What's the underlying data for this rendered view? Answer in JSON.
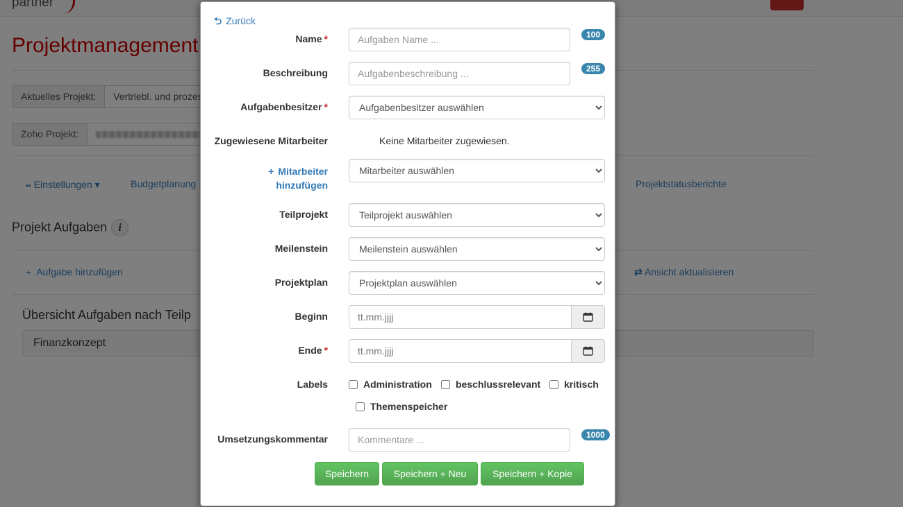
{
  "background": {
    "page_title": "Projektmanagement",
    "current_project_label": "Aktuelles Projekt:",
    "current_project_value": "Vertriebl. und prozes",
    "zoho_project_label": "Zoho Projekt:",
    "tabs": {
      "settings": "Einstellungen",
      "budget": "Budgetplanung",
      "status_reports": "Projektstatusberichte"
    },
    "tasks_heading": "Projekt Aufgaben",
    "add_task": "Aufgabe hinzufügen",
    "refresh_view": "Ansicht aktualisieren",
    "overview_heading": "Übersicht Aufgaben nach Teilp",
    "panel_title": "Finanzkonzept",
    "brand": "partner"
  },
  "modal": {
    "back_label": "Zurück",
    "name": {
      "label": "Name",
      "placeholder": "Aufgaben Name ...",
      "maxlength_badge": "100"
    },
    "description": {
      "label": "Beschreibung",
      "placeholder": "Aufgabenbeschreibung ...",
      "maxlength_badge": "255"
    },
    "owner": {
      "label": "Aufgabenbesitzer",
      "selected": "Aufgabenbesitzer auswählen"
    },
    "assigned": {
      "label": "Zugewiesene Mitarbeiter",
      "value": "Keine Mitarbeiter zugewiesen."
    },
    "add_member": {
      "label_line1": "Mitarbeiter",
      "label_line2": "hinzufügen",
      "selected": "Mitarbeiter auswählen"
    },
    "subproject": {
      "label": "Teilprojekt",
      "selected": "Teilprojekt auswählen"
    },
    "milestone": {
      "label": "Meilenstein",
      "selected": "Meilenstein auswählen"
    },
    "project_plan": {
      "label": "Projektplan",
      "selected": "Projektplan auswählen"
    },
    "start": {
      "label": "Beginn",
      "placeholder": "tt.mm.jjjj"
    },
    "end": {
      "label": "Ende",
      "placeholder": "tt.mm.jjjj"
    },
    "labels": {
      "label": "Labels",
      "options": [
        "Administration",
        "beschlussrelevant",
        "kritisch",
        "Themenspeicher"
      ]
    },
    "comment": {
      "label": "Umsetzungskommentar",
      "placeholder": "Kommentare ...",
      "maxlength_badge": "1000"
    },
    "required_marker": "*",
    "buttons": {
      "save": "Speichern",
      "save_new": "Speichern + Neu",
      "save_copy": "Speichern + Kopie"
    }
  },
  "colors": {
    "primary_red": "#cc0000",
    "link_blue": "#337ab7",
    "success_green": "#5cb85c",
    "badge_blue": "#3a87ad"
  }
}
